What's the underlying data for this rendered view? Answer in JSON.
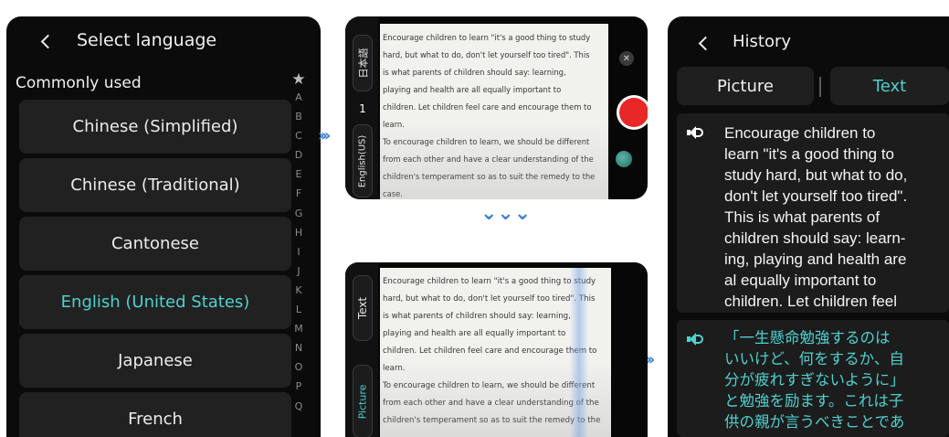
{
  "language_screen": {
    "title": "Select language",
    "section_label": "Commonly used",
    "languages": [
      {
        "label": "Chinese (Simplified)",
        "selected": false
      },
      {
        "label": "Chinese (Traditional)",
        "selected": false
      },
      {
        "label": "Cantonese",
        "selected": false
      },
      {
        "label": "English (United States)",
        "selected": true
      },
      {
        "label": "Japanese",
        "selected": false
      },
      {
        "label": "French",
        "selected": false
      }
    ],
    "index_letters": [
      "★",
      "A",
      "B",
      "C",
      "D",
      "E",
      "F",
      "G",
      "H",
      "I",
      "J",
      "K",
      "L",
      "M",
      "N",
      "O",
      "P",
      "Q"
    ]
  },
  "flow_arrows": {
    "right": "›››",
    "down": "⌄⌄⌄"
  },
  "camera_top": {
    "source_language": "日本語",
    "count": "1",
    "target_language": "English(US)",
    "document_lines": [
      "Encourage children to learn \"it's a good thing to study",
      "hard, but what to do, don't let yourself too tired\". This",
      "is what parents of children should say: learning,",
      "playing and health are all equally important to",
      "children. Let children feel care and encourage them to",
      "learn.",
      "To encourage children to learn, we should be different",
      "from each other and have a clear understanding of the",
      "children's temperament so as to suit the remedy to the",
      "case."
    ],
    "flash_symbol": "✕"
  },
  "camera_bottom": {
    "mode_text": "Text",
    "mode_picture": "Picture",
    "document_lines": [
      "Encourage children to learn \"it's a good thing to study",
      "hard, but what to do, don't let yourself too tired\". This",
      "is what parents of children should say: learning,",
      "playing and health are all equally important to",
      "children. Let children feel care and encourage them to",
      "learn.",
      "To encourage children to learn, we should be different",
      "from each other and have a clear understanding of the",
      "children's temperament so as to suit the remedy to the"
    ]
  },
  "history_screen": {
    "title": "History",
    "tabs": {
      "picture": "Picture",
      "text": "Text",
      "active": "Text"
    },
    "english_lines": [
      "Encourage children to",
      "learn \"it's a good thing to",
      "study hard, but what to do,",
      "don't let yourself too tired\".",
      "This is what parents of",
      "children should say: learn-",
      "ing, playing and health are",
      "al equally important to",
      "children. Let children feel"
    ],
    "japanese_lines": [
      "「一生懸命勉強するのは",
      "いいけど、何をするか、自",
      "分が疲れすぎないように」",
      "と勉強を励ます。これは子",
      "供の親が言うべきことであ"
    ]
  },
  "colors": {
    "accent": "#4fd0cf",
    "panel": "#212121",
    "background": "#0b0b0b",
    "shutter": "#e82727",
    "arrow": "#3b82d6"
  }
}
